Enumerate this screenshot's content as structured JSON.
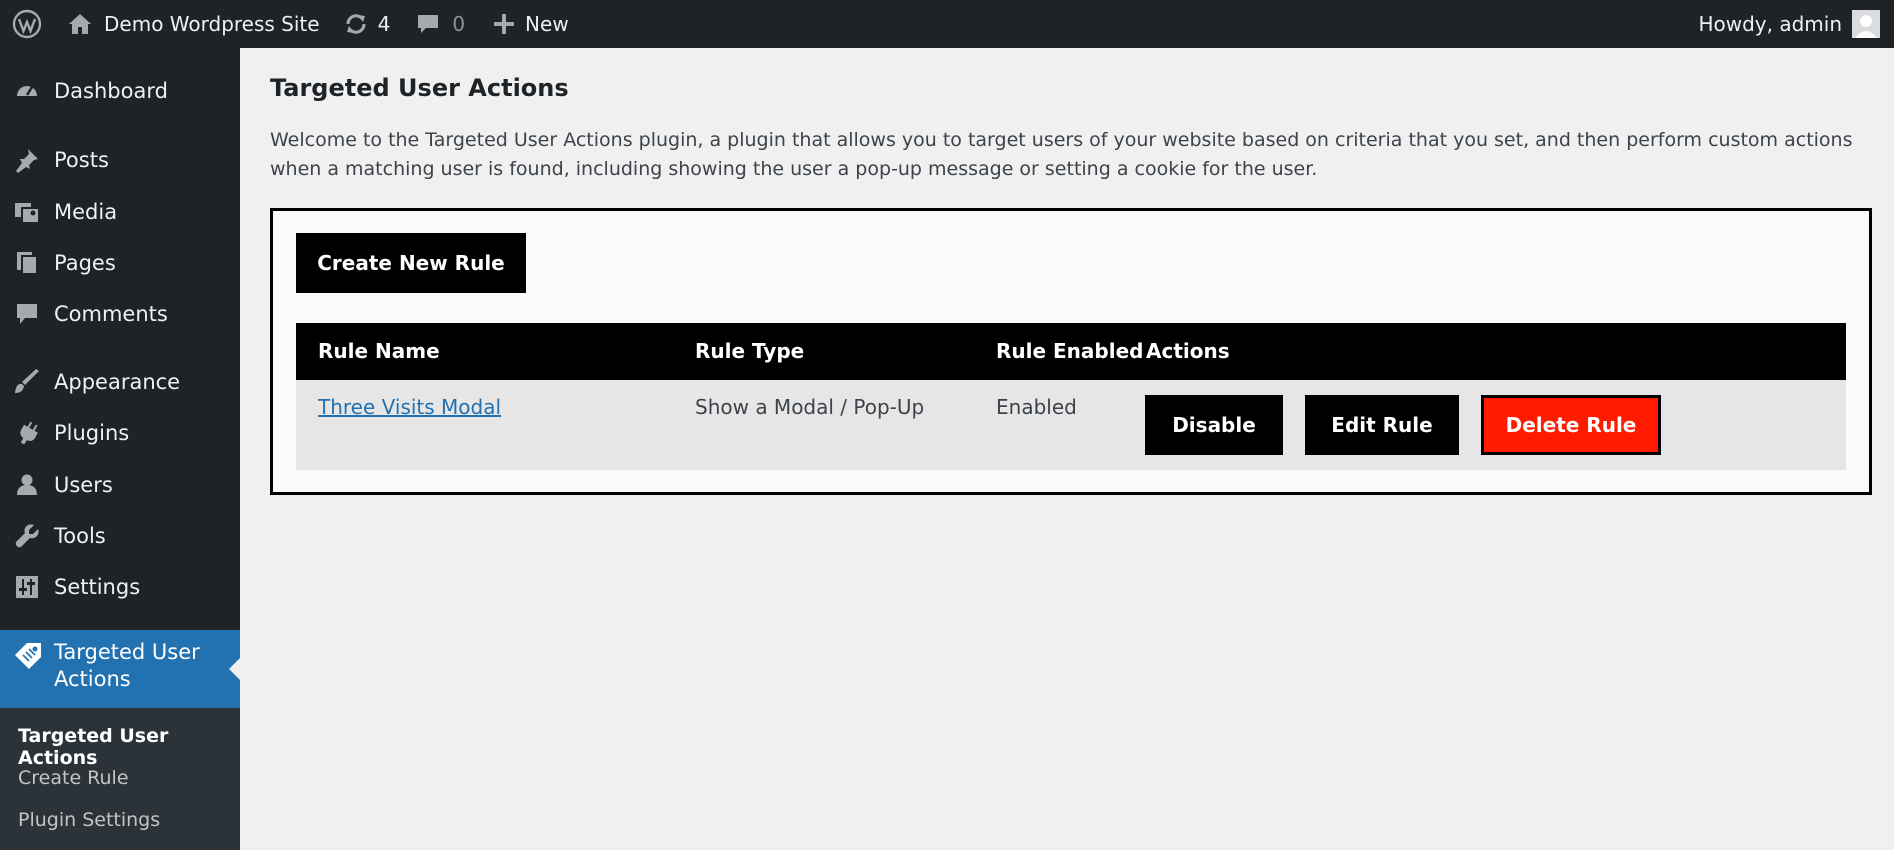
{
  "adminbar": {
    "site_name": "Demo Wordpress Site",
    "updates_count": "4",
    "comments_count": "0",
    "new_label": "New",
    "greeting": "Howdy, admin"
  },
  "sidebar": {
    "items": [
      {
        "label": "Dashboard",
        "icon": "dashboard-icon"
      },
      {
        "label": "Posts",
        "icon": "pin-icon"
      },
      {
        "label": "Media",
        "icon": "media-icon"
      },
      {
        "label": "Pages",
        "icon": "pages-icon"
      },
      {
        "label": "Comments",
        "icon": "comment-icon"
      },
      {
        "label": "Appearance",
        "icon": "brush-icon"
      },
      {
        "label": "Plugins",
        "icon": "plug-icon"
      },
      {
        "label": "Users",
        "icon": "user-icon"
      },
      {
        "label": "Tools",
        "icon": "wrench-icon"
      },
      {
        "label": "Settings",
        "icon": "sliders-icon"
      }
    ],
    "active": {
      "label": "Targeted User Actions",
      "icon": "tag-icon"
    },
    "submenu": [
      {
        "label": "Targeted User Actions",
        "current": true
      },
      {
        "label": "Create Rule",
        "current": false
      },
      {
        "label": "Plugin Settings",
        "current": false
      }
    ]
  },
  "main": {
    "title": "Targeted User Actions",
    "intro": "Welcome to the Targeted User Actions plugin, a plugin that allows you to target users of your website based on criteria that you set, and then perform custom actions when a matching user is found, including showing the user a pop-up message or setting a cookie for the user.",
    "create_button": "Create New Rule",
    "table": {
      "headers": [
        "Rule Name",
        "Rule Type",
        "Rule Enabled",
        "Actions"
      ],
      "rows": [
        {
          "name": "Three Visits Modal",
          "type": "Show a Modal / Pop-Up",
          "enabled": "Enabled",
          "actions": [
            "Disable",
            "Edit Rule",
            "Delete Rule"
          ]
        }
      ]
    }
  },
  "colors": {
    "adminbar_bg": "#1d2327",
    "active_menu": "#2271b1",
    "delete_button": "#ff1a00",
    "link": "#2271b1"
  }
}
